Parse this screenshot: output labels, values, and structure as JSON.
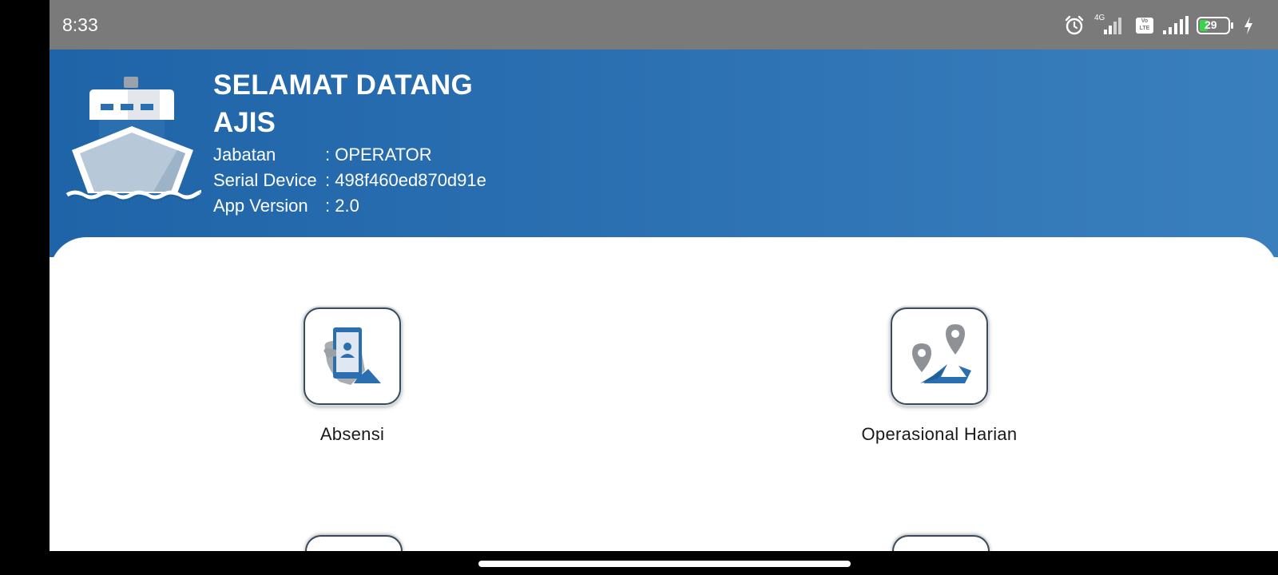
{
  "status_bar": {
    "time": "8:33",
    "network_label": "4G",
    "volte_label": "Vo LTE",
    "battery_level": "29",
    "icons": [
      "alarm-icon",
      "signal-icon",
      "volte-icon",
      "signal-icon",
      "battery-icon",
      "charging-icon"
    ]
  },
  "header": {
    "title": "SELAMAT DATANG",
    "user_name": "AJIS",
    "info": [
      {
        "label": "Jabatan",
        "value": ": OPERATOR"
      },
      {
        "label": "Serial Device",
        "value": ": 498f460ed870d91e"
      },
      {
        "label": "App Version",
        "value": ": 2.0"
      }
    ],
    "colors": {
      "header_blue": "#2c71b2",
      "accent_blue": "#2f6fb3"
    }
  },
  "menu": {
    "items": [
      {
        "label": "Absensi",
        "icon": "attendance-phone-icon"
      },
      {
        "label": "Operasional Harian",
        "icon": "route-pins-icon"
      }
    ]
  }
}
